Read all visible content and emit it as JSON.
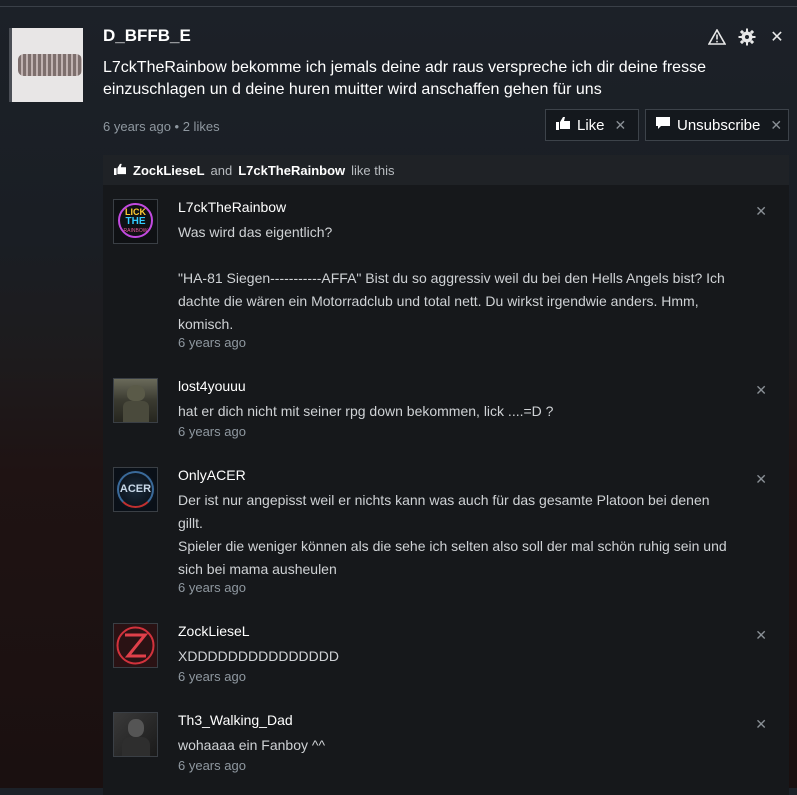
{
  "post": {
    "author": "D_BFFB_E",
    "text": "L7ckTheRainbow bekomme ich jemals deine adr raus verspreche ich dir deine fresse einzuschlagen un d deine huren muitter wird anschaffen gehen für uns",
    "time": "6 years ago",
    "likes": "2 likes",
    "like_label": "Like",
    "unsubscribe_label": "Unsubscribe",
    "icons": [
      "warning-icon",
      "gear-icon",
      "close-icon"
    ]
  },
  "likers": {
    "user1": "ZockLieseL",
    "and": "and",
    "user2": "L7ckTheRainbow",
    "suffix": "like this"
  },
  "comments": [
    {
      "author": "L7ckTheRainbow",
      "body": "Was wird das eigentlich?\n\n\"HA-81 Siegen-----------AFFA\" Bist du so aggressiv weil du bei den Hells Angels bist? Ich dachte die wären ein Motorradclub und total nett. Du wirkst irgendwie anders. Hmm, komisch.",
      "time": "6 years ago"
    },
    {
      "author": "lost4youuu",
      "body": "hat er dich nicht mit seiner rpg down bekommen, lick ....=D ?",
      "time": "6 years ago"
    },
    {
      "author": "OnlyACER",
      "body": "Der ist nur angepisst weil er nichts kann was auch für das gesamte Platoon bei denen gillt.\nSpieler die weniger können als die sehe ich selten also soll der mal schön ruhig sein und sich bei mama ausheulen",
      "time": "6 years ago"
    },
    {
      "author": "ZockLieseL",
      "body": "XDDDDDDDDDDDDDDD",
      "time": "6 years ago"
    },
    {
      "author": "Th3_Walking_Dad",
      "body": "wohaaaa ein Fanboy ^^",
      "time": "6 years ago"
    }
  ],
  "avatar_text": {
    "c0": [
      "LICK",
      "THE",
      "RAINBOW"
    ],
    "c2": "ACER"
  }
}
